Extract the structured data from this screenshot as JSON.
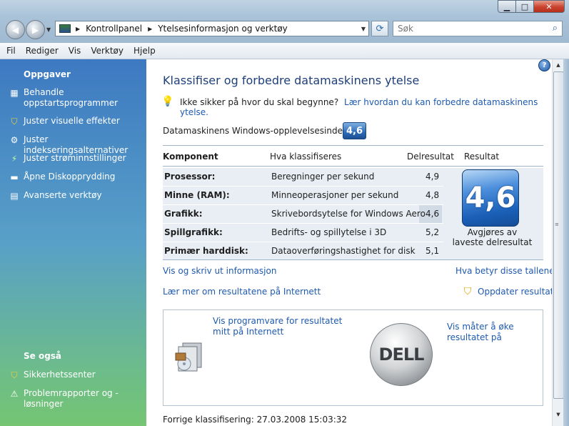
{
  "window": {
    "min": "▁",
    "max": "□",
    "close": "✕"
  },
  "nav": {
    "back_icon": "arrow-left",
    "forward_icon": "arrow-right"
  },
  "address": {
    "crumbs": [
      "Kontrollpanel",
      "Ytelsesinformasjon og verktøy"
    ]
  },
  "search": {
    "placeholder": "Søk"
  },
  "menu": [
    "Fil",
    "Rediger",
    "Vis",
    "Verktøy",
    "Hjelp"
  ],
  "sidebar": {
    "tasks_heading": "Oppgaver",
    "tasks": [
      {
        "label": "Behandle oppstartsprogrammer",
        "icon": "startup-programs-icon"
      },
      {
        "label": "Juster visuelle effekter",
        "icon": "shield-icon"
      },
      {
        "label": "Juster indekseringsalternativer",
        "icon": "indexing-icon"
      },
      {
        "label": "Juster strøminnstillinger",
        "icon": "power-icon"
      },
      {
        "label": "Åpne Diskopprydding",
        "icon": "disk-cleanup-icon"
      },
      {
        "label": "Avanserte verktøy",
        "icon": "advanced-tools-icon"
      }
    ],
    "seealso_heading": "Se også",
    "seealso": [
      {
        "label": "Sikkerhetssenter",
        "icon": "shield-icon"
      },
      {
        "label": "Problemrapporter og -løsninger",
        "icon": "problem-reports-icon"
      }
    ]
  },
  "main": {
    "title": "Klassifiser og forbedre datamaskinens ytelse",
    "tip_text": "Ikke sikker på hvor du skal begynne?",
    "tip_link": "Lær hvordan du kan forbedre datamaskinens ytelse.",
    "wei_label": "Datamaskinens Windows-opplevelsesindeks er",
    "wei_value": "4,6",
    "table": {
      "headers": [
        "Komponent",
        "Hva klassifiseres",
        "Delresultat",
        "Resultat"
      ],
      "rows": [
        {
          "component": "Prosessor:",
          "what": "Beregninger per sekund",
          "score": "4,9"
        },
        {
          "component": "Minne (RAM):",
          "what": "Minneoperasjoner per sekund",
          "score": "4,8"
        },
        {
          "component": "Grafikk:",
          "what": "Skrivebordsytelse for Windows Aero",
          "score": "4,6"
        },
        {
          "component": "Spillgrafikk:",
          "what": "Bedrifts- og spillytelse i 3D",
          "score": "5,2"
        },
        {
          "component": "Primær harddisk:",
          "what": "Dataoverføringshastighet for disk",
          "score": "5,1"
        }
      ],
      "base_score": "4,6",
      "base_caption": "Avgjøres av laveste delresultat"
    },
    "links": {
      "print": "Vis og skriv ut informasjon",
      "meaning": "Hva betyr disse tallene?",
      "learn_online": "Lær mer om resultatene på Internett",
      "update": "Oppdater resultat"
    },
    "offers": {
      "software": "Vis programvare for resultatet mitt på Internett",
      "improve": "Vis måter å øke resultatet på",
      "dell_logo": "DELL"
    },
    "previous": "Forrige klassifisering: 27.03.2008 15:03:32"
  }
}
